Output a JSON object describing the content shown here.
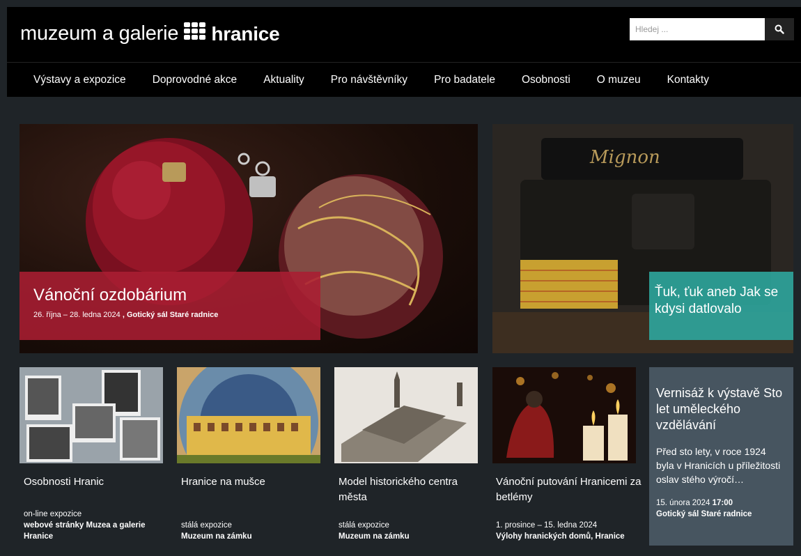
{
  "header": {
    "logo_part1": "muzeum a galerie",
    "logo_part2": "hranice",
    "search_placeholder": "Hledej ...",
    "search_icon": "search-icon"
  },
  "nav": {
    "items": [
      "Výstavy a expozice",
      "Doprovodné akce",
      "Aktuality",
      "Pro návštěvníky",
      "Pro badatele",
      "Osobnosti",
      "O muzeu",
      "Kontakty"
    ]
  },
  "hero": {
    "left": {
      "title": "Vánoční ozdobárium",
      "date": "26. října – 28. ledna 2024",
      "place": ", Gotický sál Staré radnice",
      "accent": "#aa1e32"
    },
    "right": {
      "title": "Ťuk, ťuk aneb Jak se kdysi datlovalo",
      "accent": "#2eaaa0"
    }
  },
  "tiles": [
    {
      "title": "Osobnosti Hranic",
      "type": "on-line expozice",
      "place": "webové stránky Muzea a galerie Hranice"
    },
    {
      "title": "Hranice na mušce",
      "type": "stálá expozice",
      "place": "Muzeum na zámku"
    },
    {
      "title": "Model historického centra města",
      "type": "stálá expozice",
      "place": "Muzeum na zámku"
    },
    {
      "title": "Vánoční putování Hranicemi za betlémy",
      "type": "1. prosince – 15. ledna 2024",
      "place": "Výlohy hranických domů, Hranice"
    }
  ],
  "side": {
    "title": "Vernisáž k výstavě Sto let uměleckého vzdělávání",
    "desc": "Před sto lety, v roce 1924 byla v Hranicích u příležitosti oslav stého výročí…",
    "date": "15. února 2024",
    "time": "17:00",
    "place": "Gotický sál Staré radnice"
  }
}
